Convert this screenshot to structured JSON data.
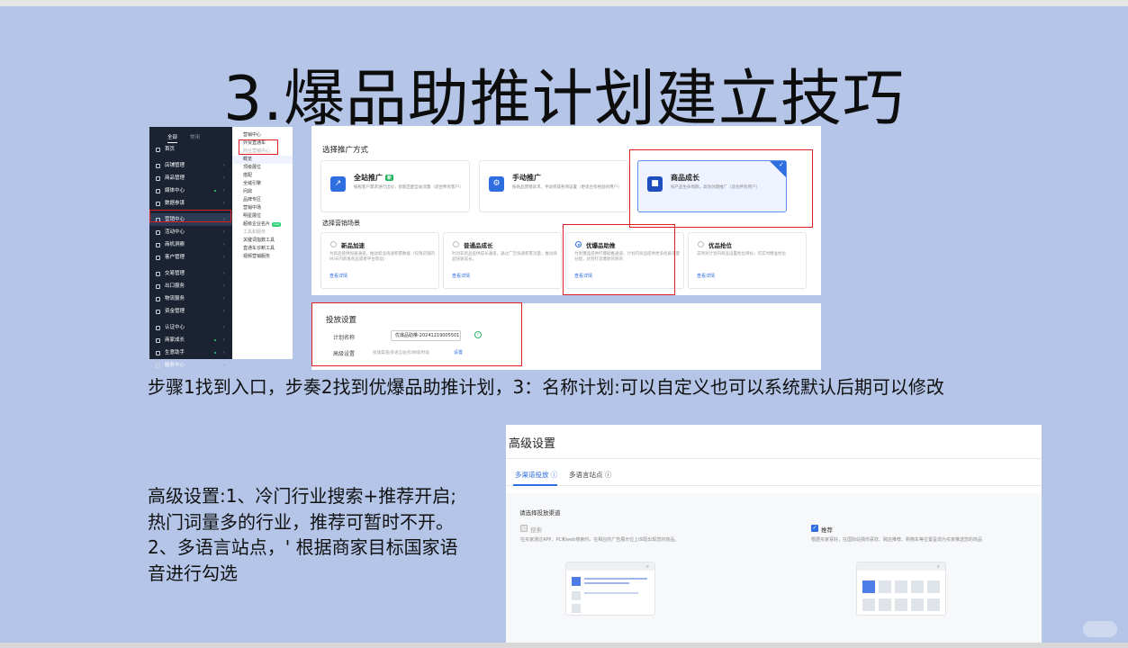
{
  "slide_title": "3.爆品助推计划建立技巧",
  "nav": {
    "tab_all": "全部",
    "tab_common": "常用",
    "items": [
      {
        "label": "首页"
      },
      {
        "label": "店铺管理"
      },
      {
        "label": "商品管理"
      },
      {
        "label": "媒体中心"
      },
      {
        "label": "数据参谋"
      },
      {
        "label": "营销中心"
      },
      {
        "label": "活动中心"
      },
      {
        "label": "商机洞察"
      },
      {
        "label": "客户管理"
      },
      {
        "label": "交易管理"
      },
      {
        "label": "出口服务"
      },
      {
        "label": "物流服务"
      },
      {
        "label": "资金管理"
      },
      {
        "label": "认证中心"
      },
      {
        "label": "商家成长"
      },
      {
        "label": "生意助手"
      },
      {
        "label": "服务中心"
      }
    ]
  },
  "submenu": {
    "items": [
      "营销中心",
      "外贸直通车",
      "商业营销中心",
      "概览",
      "顶级展位",
      "搭配",
      "全域引擎",
      "问鼎",
      "品牌专区",
      "营销中场",
      "明星展位",
      "超级企业名片",
      "工具和服务",
      "关键词指数工具",
      "直通车诊断工具",
      "视频营销服务"
    ],
    "new_badge": "new"
  },
  "promo": {
    "heading": "选择推广方式",
    "cards": [
      {
        "title": "全站推广",
        "badge": "新",
        "desc": "按照客戶需求进行出价，智能匹配全站流量（适合所有客户）"
      },
      {
        "title": "手动推广",
        "desc": "按商品营销诉求，手动完成各项设置（更适合有经验的用户）"
      },
      {
        "title": "商品成长",
        "desc": "按产品生命周期，高效创建推广（适合所有用户）"
      }
    ],
    "scene_heading": "选择营销场景",
    "scenes": [
      {
        "title": "新品加速",
        "desc": "为新品提供加速通道，推动新品快速积累数据（仅限店铺内90天内新发商品或者平台新品）",
        "link": "查看详情"
      },
      {
        "title": "普通品成长",
        "desc": "针对非新品提供成长通道，通过广告快速积累流量，推动商品快速成长。",
        "link": "查看详情"
      },
      {
        "title": "优爆品助推",
        "desc": "为优爆品提供打爆助推通道，计划内商品提供更多优质流量分配，达到打造爆款的目的",
        "link": "查看详情"
      },
      {
        "title": "优品抢位",
        "desc": "支持对计划内商品设置抢位目标，可实时精准抢位",
        "link": "查看详情"
      }
    ]
  },
  "settings": {
    "heading": "投放设置",
    "plan_name_label": "计划名称",
    "plan_name_value": "优爆品助推-20241219005501",
    "advanced_label": "高级设置",
    "advanced_summary": "投放渠道/多语言站点/地域/时段",
    "advanced_link": "设置"
  },
  "step_text": "步骤1找到入口，步奏2找到优爆品助推计划，3：名称计划:可以自定义也可以系统默认后期可以修改",
  "note_text": "高级设置:1、冷门行业搜索+推荐开启;热门词量多的行业，推荐可暂时不开。2、多语言站点，' 根据商家目标国家语音进行勾选",
  "advanced_panel": {
    "title": "高级设置",
    "tabs": [
      "多渠道投放",
      "多语言站点"
    ],
    "channel_heading": "请选择投放渠道",
    "options": [
      {
        "label": "搜索",
        "checked": false,
        "desc": "在买家通过APP、PC和web搜索时，在相应的广告展示位上匹配出现您的商品。"
      },
      {
        "label": "推荐",
        "checked": true,
        "desc": "根据买家喜好，在国际站猜你喜欢、跨店推荐、购物车等位置呈现为买家推送您的商品"
      }
    ]
  },
  "colors": {
    "background": "#b4c5e8",
    "accent": "#2f6ee0",
    "highlight_box": "#e02020"
  }
}
